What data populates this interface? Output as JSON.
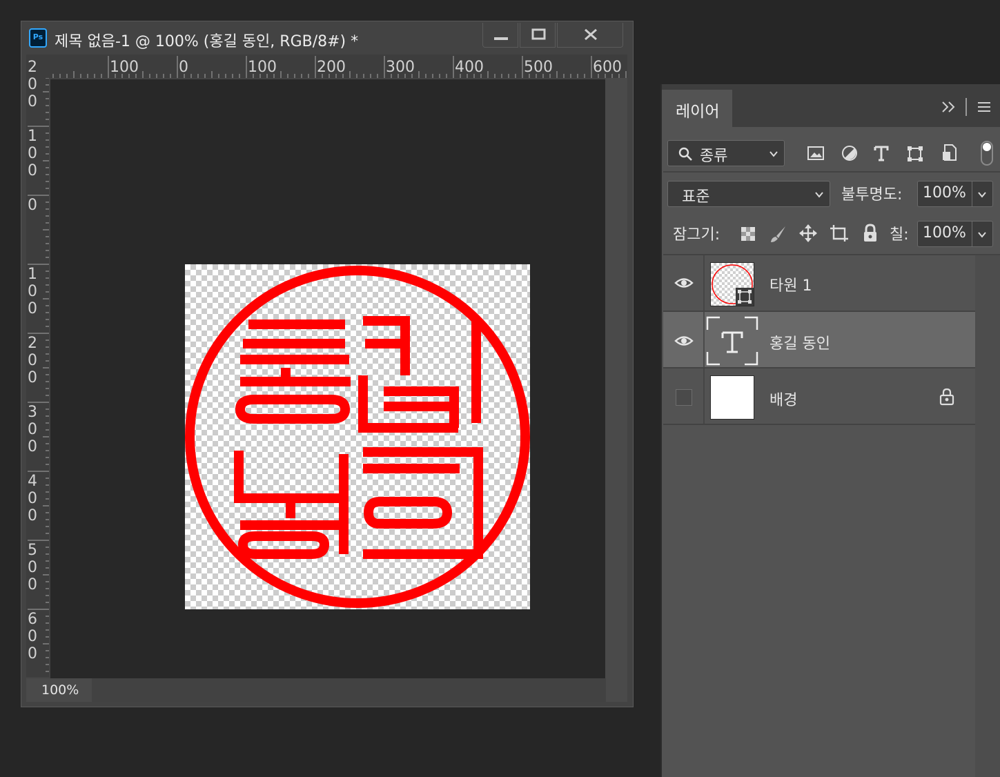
{
  "document_window": {
    "app_icon": "Ps",
    "title": "제목 없음-1 @ 100% (홍길 동인, RGB/8#) *",
    "controls": {
      "minimize_icon": "minimize-icon",
      "maximize_icon": "maximize-icon",
      "close_icon": "close-icon"
    },
    "ruler_horizontal_labels": [
      "100",
      "0",
      "100",
      "200",
      "300",
      "400",
      "500",
      "600"
    ],
    "ruler_vertical_labels": [
      "200",
      "100",
      "0",
      "100",
      "200",
      "300",
      "400",
      "500",
      "600"
    ],
    "status_zoom": "100%",
    "canvas": {
      "stamp_text": "홍길 동인",
      "stamp_color": "#ff0000",
      "background": "transparent-checkerboard"
    }
  },
  "layers_panel": {
    "tab_label": "레이어",
    "menu_icons": [
      "collapse-icon",
      "panel-menu-icon"
    ],
    "filter": {
      "icon": "search-icon",
      "value": "종류"
    },
    "filter_icons": [
      "image-filter-icon",
      "adjustment-filter-icon",
      "type-filter-icon",
      "shape-filter-icon",
      "smart-object-filter-icon"
    ],
    "blend_mode": "표준",
    "opacity_label": "불투명도:",
    "opacity_value": "100%",
    "lock_label": "잠그기:",
    "lock_icons": [
      "lock-transparent-icon",
      "lock-paint-icon",
      "lock-move-icon",
      "lock-artboard-icon",
      "lock-all-icon"
    ],
    "fill_label": "칠:",
    "fill_value": "100%",
    "layers": [
      {
        "name": "타원 1",
        "type": "shape",
        "visible": true,
        "selected": false
      },
      {
        "name": "홍길 동인",
        "type": "text",
        "visible": true,
        "selected": true
      },
      {
        "name": "배경",
        "type": "background",
        "visible": false,
        "selected": false,
        "locked": true
      }
    ]
  },
  "colors": {
    "accent": "#31a8ff",
    "stamp": "#ff0000",
    "panel_bg": "#535353",
    "selected_row": "#696969"
  }
}
